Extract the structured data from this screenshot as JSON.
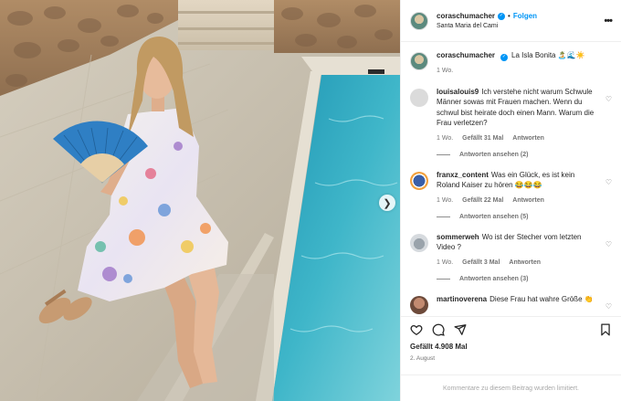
{
  "post": {
    "username": "coraschumacher",
    "follow_label": "Folgen",
    "location": "Santa Maria del Cami",
    "caption": "La Isla Bonita 🏝️🌊☀️",
    "caption_time": "1 Wo.",
    "likes": "Gefällt 4.908 Mal",
    "date": "2. August",
    "comments_limited": "Kommentare zu diesem Beitrag wurden limitiert."
  },
  "comments": [
    {
      "username": "louisalouis9",
      "text": "Ich verstehe nicht warum Schwule Männer sowas mit Frauen machen. Wenn du schwul bist heirate doch einen Mann. Warum die Frau verletzen?",
      "time": "1 Wo.",
      "likes": "Gefällt 31 Mal",
      "reply_label": "Antworten",
      "replies": "Antworten ansehen (2)"
    },
    {
      "username": "franxz_content",
      "text": "Was ein Glück, es ist kein Roland Kaiser zu hören 😂😂😂",
      "time": "1 Wo.",
      "likes": "Gefällt 22 Mal",
      "reply_label": "Antworten",
      "replies": "Antworten ansehen (5)"
    },
    {
      "username": "sommerweh",
      "text": "Wo ist der Stecher vom letzten Video ?",
      "time": "1 Wo.",
      "likes": "Gefällt 3 Mal",
      "reply_label": "Antworten",
      "replies": "Antworten ansehen (3)"
    },
    {
      "username": "martinoverena",
      "text": "Diese Frau hat wahre Größe 👏"
    }
  ],
  "icons": {
    "header_more": "more-horizontal-icon",
    "like": "heart-icon",
    "comment": "comment-icon",
    "share": "share-icon",
    "save": "bookmark-icon",
    "next": "chevron-right-icon"
  },
  "colors": {
    "accent": "#0095f6",
    "pool": "#3fb6c9",
    "fan": "#2f7fc4"
  }
}
